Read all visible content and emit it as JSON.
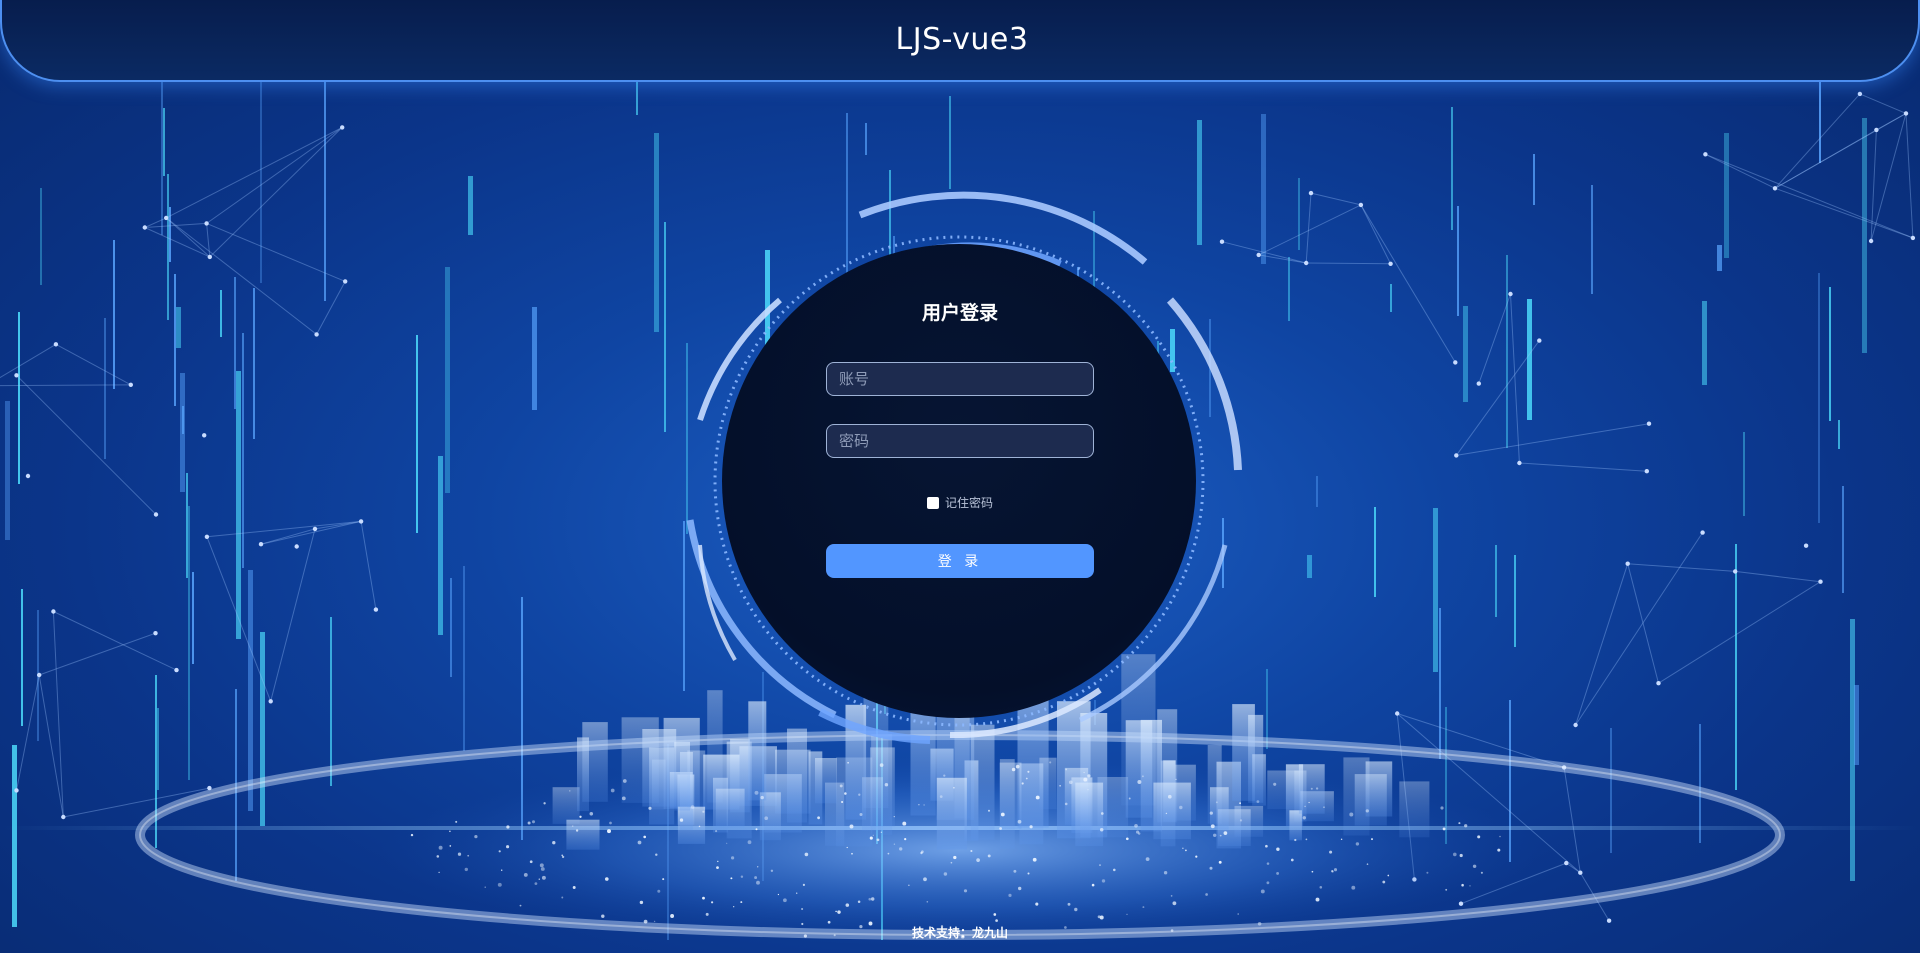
{
  "header": {
    "title": "LJS-vue3"
  },
  "login": {
    "heading": "用户登录",
    "account_placeholder": "账号",
    "password_placeholder": "密码",
    "remember_label": "记住密码",
    "remember_checked": false,
    "submit_label": "登 录"
  },
  "footer": {
    "credit": "技术支持：龙九山"
  },
  "colors": {
    "background": "#0f45a3",
    "header_bg": "#0b2a63",
    "accent": "#5296ff",
    "input_bg": "#1d2b4f",
    "disc_bg": "#040f29"
  }
}
